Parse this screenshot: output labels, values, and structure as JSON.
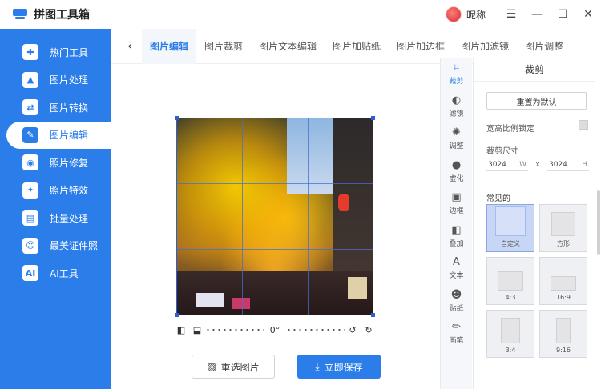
{
  "app": {
    "title": "拼图工具箱",
    "nickname": "昵称"
  },
  "window_controls": {
    "menu": "☰",
    "minimize": "—",
    "maximize": "☐",
    "close": "✕"
  },
  "sidebar": {
    "items": [
      {
        "label": "热门工具",
        "icon": "hot-tools-icon",
        "glyph": "✚"
      },
      {
        "label": "图片处理",
        "icon": "image-process-icon",
        "glyph": "▲"
      },
      {
        "label": "图片转换",
        "icon": "image-convert-icon",
        "glyph": "⇄"
      },
      {
        "label": "图片编辑",
        "icon": "image-edit-icon",
        "glyph": "✎",
        "active": true
      },
      {
        "label": "照片修复",
        "icon": "photo-repair-icon",
        "glyph": "◉"
      },
      {
        "label": "照片特效",
        "icon": "photo-effects-icon",
        "glyph": "✦"
      },
      {
        "label": "批量处理",
        "icon": "batch-process-icon",
        "glyph": "▤"
      },
      {
        "label": "最美证件照",
        "icon": "id-photo-icon",
        "glyph": "☺"
      },
      {
        "label": "AI工具",
        "icon": "ai-tools-icon",
        "glyph": "AI"
      }
    ]
  },
  "tabs": {
    "back": "‹",
    "items": [
      "图片编辑",
      "图片裁剪",
      "图片文本编辑",
      "图片加贴纸",
      "图片加边框",
      "图片加滤镜",
      "图片调整"
    ]
  },
  "editor": {
    "rotation_angle": "0°",
    "reselect_label": "重选图片",
    "save_label": "立即保存"
  },
  "tools": [
    {
      "label": "裁剪",
      "icon": "crop-icon",
      "glyph": "⌗",
      "active": true
    },
    {
      "label": "滤镜",
      "icon": "filter-icon",
      "glyph": "◐"
    },
    {
      "label": "调整",
      "icon": "adjust-icon",
      "glyph": "✺"
    },
    {
      "label": "虚化",
      "icon": "blur-icon",
      "glyph": "●"
    },
    {
      "label": "边框",
      "icon": "border-icon",
      "glyph": "▣"
    },
    {
      "label": "叠加",
      "icon": "overlay-icon",
      "glyph": "◧"
    },
    {
      "label": "文本",
      "icon": "text-icon",
      "glyph": "A"
    },
    {
      "label": "贴纸",
      "icon": "sticker-icon",
      "glyph": "☻"
    },
    {
      "label": "画笔",
      "icon": "brush-icon",
      "glyph": "✏"
    }
  ],
  "crop_panel": {
    "title": "裁剪",
    "reset_label": "重置为默认",
    "lock_ratio_label": "宽高比例锁定",
    "size_label": "裁剪尺寸",
    "width_value": "3024",
    "width_unit": "W",
    "x_sep": "x",
    "height_value": "3024",
    "height_unit": "H",
    "common_label": "常见的",
    "ratios": [
      "自定义",
      "方形",
      "4:3",
      "16:9",
      "3:4",
      "9:16"
    ]
  },
  "colors": {
    "accent": "#2b7de9",
    "crop_line": "#2b5fd8"
  }
}
